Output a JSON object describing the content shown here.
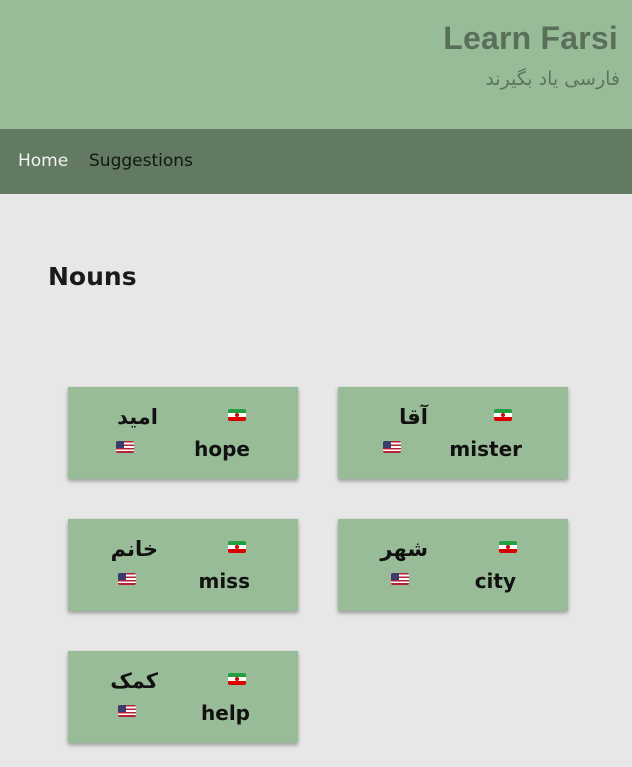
{
  "header": {
    "title": "Learn Farsi",
    "subtitle": "فارسی یاد بگیرند"
  },
  "nav": {
    "items": [
      {
        "label": "Home"
      },
      {
        "label": "Suggestions"
      }
    ]
  },
  "main": {
    "heading": "Nouns",
    "cards": [
      {
        "farsi": "امید",
        "english": "hope"
      },
      {
        "farsi": "آقا",
        "english": "mister"
      },
      {
        "farsi": "خانم",
        "english": "miss"
      },
      {
        "farsi": "شهر",
        "english": "city"
      },
      {
        "farsi": "کمک",
        "english": "help"
      }
    ]
  },
  "icons": {
    "farsi_flag": "iran-flag-icon",
    "english_flag": "us-flag-icon"
  },
  "colors": {
    "header_bg": "#98bc98",
    "nav_bg": "#627a62",
    "page_bg": "#e7e7e7",
    "card_bg": "#98bc98"
  }
}
